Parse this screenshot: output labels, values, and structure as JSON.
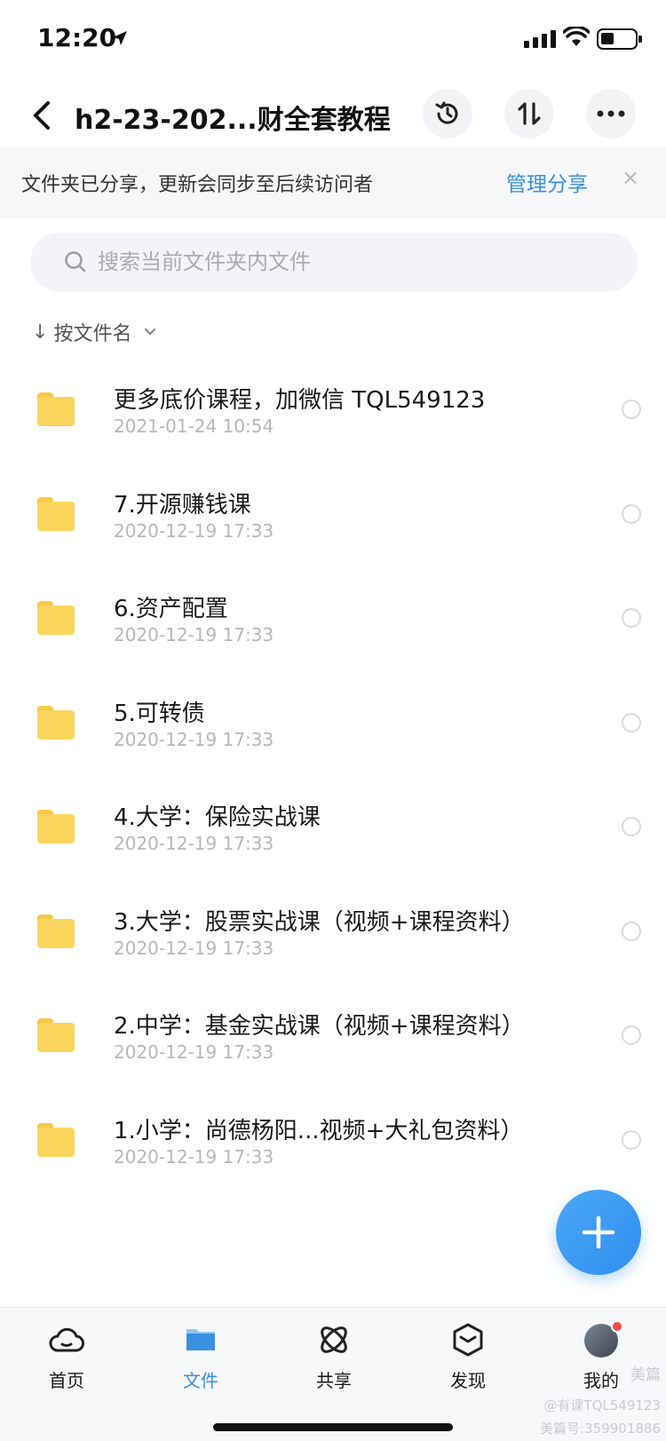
{
  "status_bar": {
    "time": "12:20"
  },
  "header": {
    "title": "h2-23-202...财全套教程"
  },
  "share_banner": {
    "text": "文件夹已分享，更新会同步至后续访问者",
    "manage": "管理分享",
    "close": "×"
  },
  "search": {
    "placeholder": "搜索当前文件夹内文件"
  },
  "sort": {
    "arrow": "↓",
    "label": "按文件名"
  },
  "files": [
    {
      "name": "更多底价课程，加微信 TQL549123",
      "date": "2021-01-24 10:54"
    },
    {
      "name": "7.开源赚钱课",
      "date": "2020-12-19 17:33"
    },
    {
      "name": "6.资产配置",
      "date": "2020-12-19 17:33"
    },
    {
      "name": "5.可转债",
      "date": "2020-12-19 17:33"
    },
    {
      "name": "4.大学：保险实战课",
      "date": "2020-12-19 17:33"
    },
    {
      "name": "3.大学：股票实战课（视频+课程资料）",
      "date": "2020-12-19 17:33"
    },
    {
      "name": "2.中学：基金实战课（视频+课程资料）",
      "date": "2020-12-19 17:33"
    },
    {
      "name": "1.小学：尚德杨阳...视频+大礼包资料）",
      "date": "2020-12-19 17:33"
    }
  ],
  "tabs": [
    {
      "label": "首页",
      "icon": "cloud-icon"
    },
    {
      "label": "文件",
      "icon": "folder-icon",
      "active": true
    },
    {
      "label": "共享",
      "icon": "atom-icon"
    },
    {
      "label": "发现",
      "icon": "cube-icon"
    },
    {
      "label": "我的",
      "icon": "avatar"
    }
  ],
  "watermarks": {
    "brand": "美篇",
    "line1": "@有课TQL549123",
    "line2": "美篇号:359901886"
  },
  "colors": {
    "accent": "#3a91e0",
    "folder": "#fbd45c",
    "fab": "#2f8ef0"
  }
}
